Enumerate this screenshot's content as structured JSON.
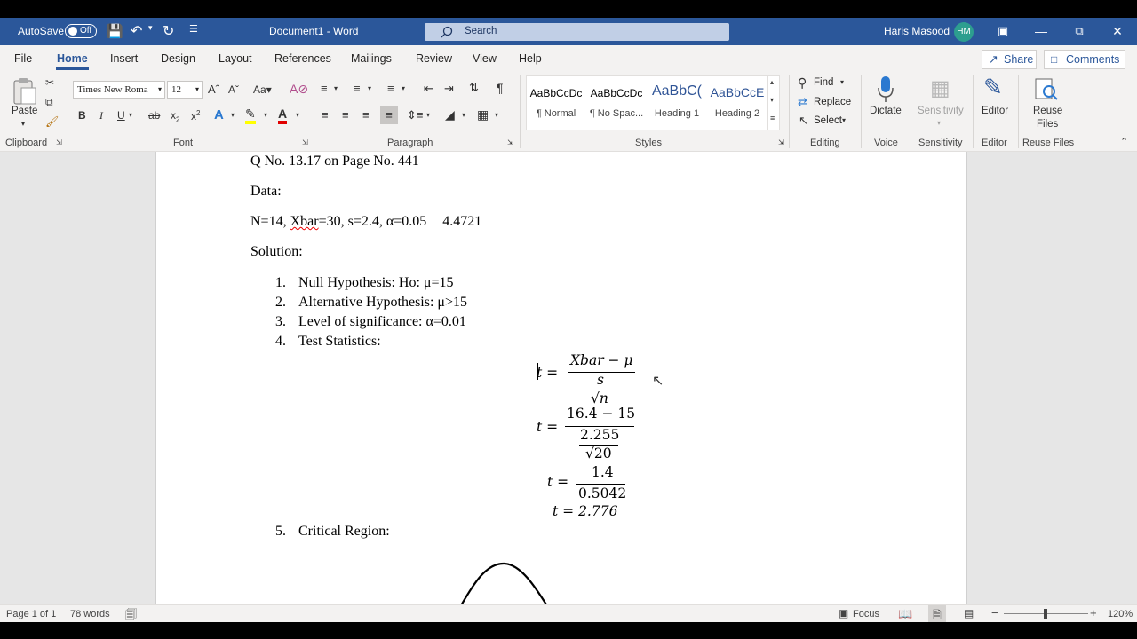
{
  "titlebar": {
    "autosave_label": "AutoSave",
    "autosave_state": "Off",
    "doc_title": "Document1 - Word",
    "search_placeholder": "Search",
    "user_name": "Haris Masood",
    "user_initials": "HM"
  },
  "tabs": [
    "File",
    "Home",
    "Insert",
    "Design",
    "Layout",
    "References",
    "Mailings",
    "Review",
    "View",
    "Help"
  ],
  "active_tab": "Home",
  "share_label": "Share",
  "comments_label": "Comments",
  "ribbon": {
    "clipboard": {
      "paste": "Paste",
      "group": "Clipboard"
    },
    "font": {
      "family": "Times New Roma",
      "size": "12",
      "group": "Font",
      "case": "Aa"
    },
    "paragraph": {
      "group": "Paragraph"
    },
    "styles": {
      "items": [
        {
          "preview": "AaBbCcDc",
          "name": "¶ Normal"
        },
        {
          "preview": "AaBbCcDc",
          "name": "¶ No Spac..."
        },
        {
          "preview": "AaBbC(",
          "name": "Heading 1"
        },
        {
          "preview": "AaBbCcE",
          "name": "Heading 2"
        }
      ],
      "group": "Styles"
    },
    "editing": {
      "find": "Find",
      "replace": "Replace",
      "select": "Select",
      "group": "Editing"
    },
    "voice": {
      "dictate": "Dictate",
      "group": "Voice"
    },
    "sensitivity": {
      "label": "Sensitivity",
      "group": "Sensitivity"
    },
    "editor": {
      "label": "Editor",
      "group": "Editor"
    },
    "reuse": {
      "label1": "Reuse",
      "label2": "Files",
      "group": "Reuse Files"
    }
  },
  "document": {
    "heading": "Q No. 13.17 on Page No. 441",
    "data_label": "Data:",
    "data_line_prefix": "N=14, ",
    "data_line_xbar": "Xbar",
    "data_line_rest": "=30, s=2.4, α=0.05",
    "data_line_extra": "4.4721",
    "solution_label": "Solution:",
    "steps": [
      {
        "num": "1.",
        "text": "Null Hypothesis: Ho: μ=15"
      },
      {
        "num": "2.",
        "text": "Alternative Hypothesis: μ>15"
      },
      {
        "num": "3.",
        "text": "Level of significance: α=0.01"
      },
      {
        "num": "4.",
        "text": "Test Statistics:"
      },
      {
        "num": "5.",
        "text": "Critical Region:"
      }
    ],
    "eq1": {
      "lhs": "t =",
      "num": "Xbar − μ",
      "den_num": "s",
      "den_den": "√n"
    },
    "eq2": {
      "lhs": "t =",
      "num": "16.4 − 15",
      "den_num": "2.255",
      "den_den": "√20"
    },
    "eq3": {
      "lhs": "t =",
      "num": "1.4",
      "den": "0.5042"
    },
    "eq4": "t = 2.776"
  },
  "statusbar": {
    "page": "Page 1 of 1",
    "words": "78 words",
    "focus": "Focus",
    "zoom": "120%"
  }
}
